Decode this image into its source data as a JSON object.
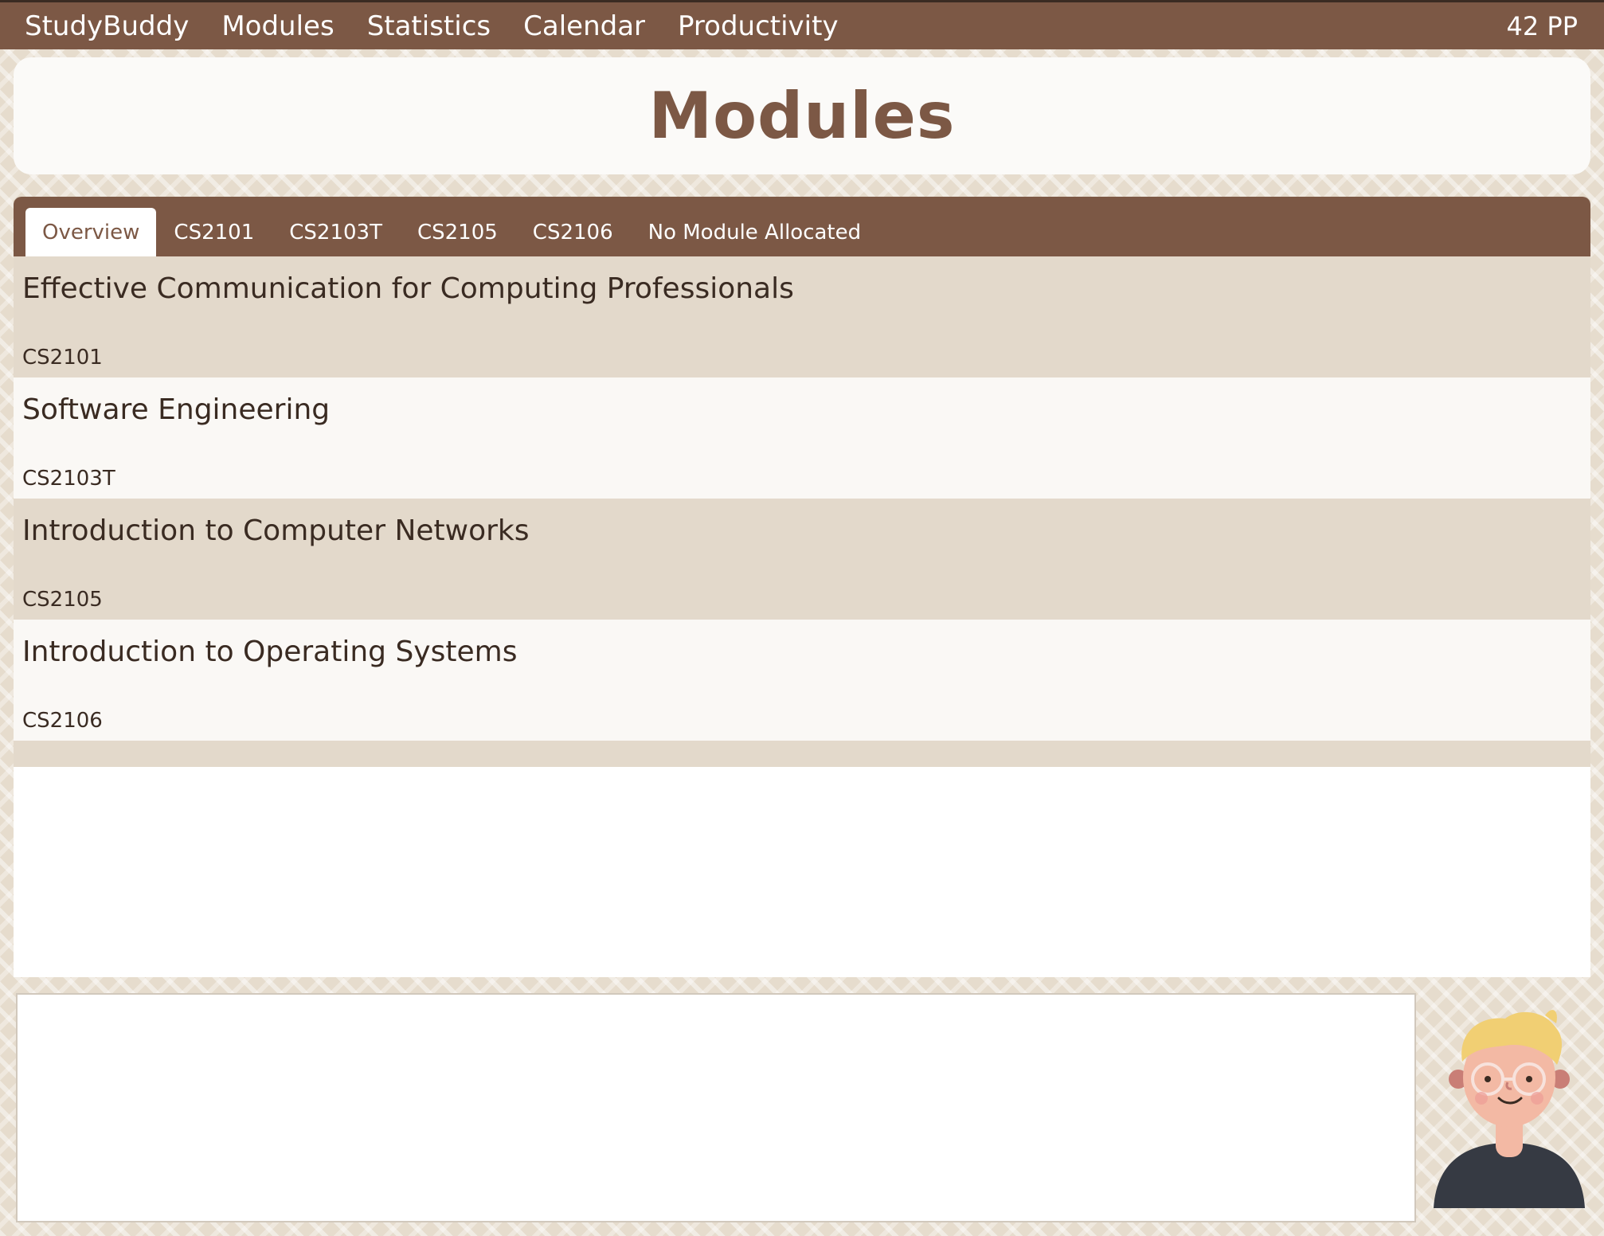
{
  "topbar": {
    "brand": "StudyBuddy",
    "links": [
      "Modules",
      "Statistics",
      "Calendar",
      "Productivity"
    ],
    "points": "42 PP"
  },
  "page": {
    "title": "Modules"
  },
  "tabs": [
    "Overview",
    "CS2101",
    "CS2103T",
    "CS2105",
    "CS2106",
    "No Module Allocated"
  ],
  "active_tab": "Overview",
  "modules": [
    {
      "name": "Effective Communication for Computing Professionals",
      "code": "CS2101"
    },
    {
      "name": "Software Engineering",
      "code": "CS2103T"
    },
    {
      "name": "Introduction to Computer Networks",
      "code": "CS2105"
    },
    {
      "name": "Introduction to Operating Systems",
      "code": "CS2106"
    }
  ],
  "colors": {
    "brand_brown": "#7c5845",
    "row_tan": "#e3d9cb",
    "row_light": "#faf8f5"
  },
  "icons": {
    "mascot": "student-avatar-icon"
  }
}
